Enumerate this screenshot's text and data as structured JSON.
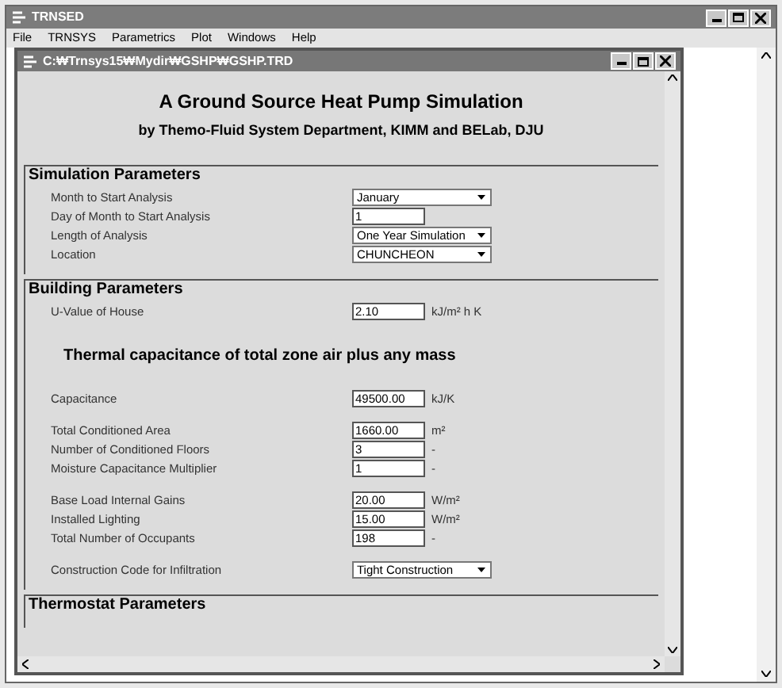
{
  "window": {
    "title": "TRNSED"
  },
  "menu": [
    "File",
    "TRNSYS",
    "Parametrics",
    "Plot",
    "Windows",
    "Help"
  ],
  "document": {
    "title": "C:₩Trnsys15₩Mydir₩GSHP₩GSHP.TRD",
    "heading": "A Ground Source Heat Pump Simulation",
    "subheading": "by Themo-Fluid System Department, KIMM and BELab, DJU",
    "sections": [
      {
        "title": "Simulation Parameters",
        "groups": [
          [
            {
              "kind": "dropdown",
              "label": "Month to Start Analysis",
              "value": "January"
            },
            {
              "kind": "field",
              "label": "Day of Month to Start Analysis",
              "value": "1"
            },
            {
              "kind": "dropdown",
              "label": "Length of Analysis",
              "value": "One Year Simulation"
            },
            {
              "kind": "dropdown",
              "label": "Location",
              "value": "CHUNCHEON"
            }
          ]
        ]
      },
      {
        "title": "Building Parameters",
        "groups": [
          [
            {
              "kind": "field",
              "label": "U-Value of House",
              "value": "2.10",
              "unit": "kJ/m² h K"
            }
          ],
          [
            {
              "kind": "heading",
              "label": "Thermal capacitance of total zone air plus any mass"
            }
          ],
          [
            {
              "kind": "field",
              "label": "Capacitance",
              "value": "49500.00",
              "unit": "kJ/K"
            }
          ],
          [
            {
              "kind": "field",
              "label": "Total Conditioned Area",
              "value": "1660.00",
              "unit": "m²"
            },
            {
              "kind": "field",
              "label": "Number of Conditioned Floors",
              "value": "3",
              "unit": "-"
            },
            {
              "kind": "field",
              "label": "Moisture Capacitance Multiplier",
              "value": "1",
              "unit": "-"
            }
          ],
          [
            {
              "kind": "field",
              "label": "Base Load Internal Gains",
              "value": "20.00",
              "unit": "W/m²"
            },
            {
              "kind": "field",
              "label": "Installed Lighting",
              "value": "15.00",
              "unit": "W/m²"
            },
            {
              "kind": "field",
              "label": "Total Number of Occupants",
              "value": "198",
              "unit": "-"
            }
          ],
          [
            {
              "kind": "dropdown",
              "label": "Construction Code for Infiltration",
              "value": "Tight Construction"
            }
          ]
        ]
      },
      {
        "title": "Thermostat Parameters"
      }
    ]
  }
}
